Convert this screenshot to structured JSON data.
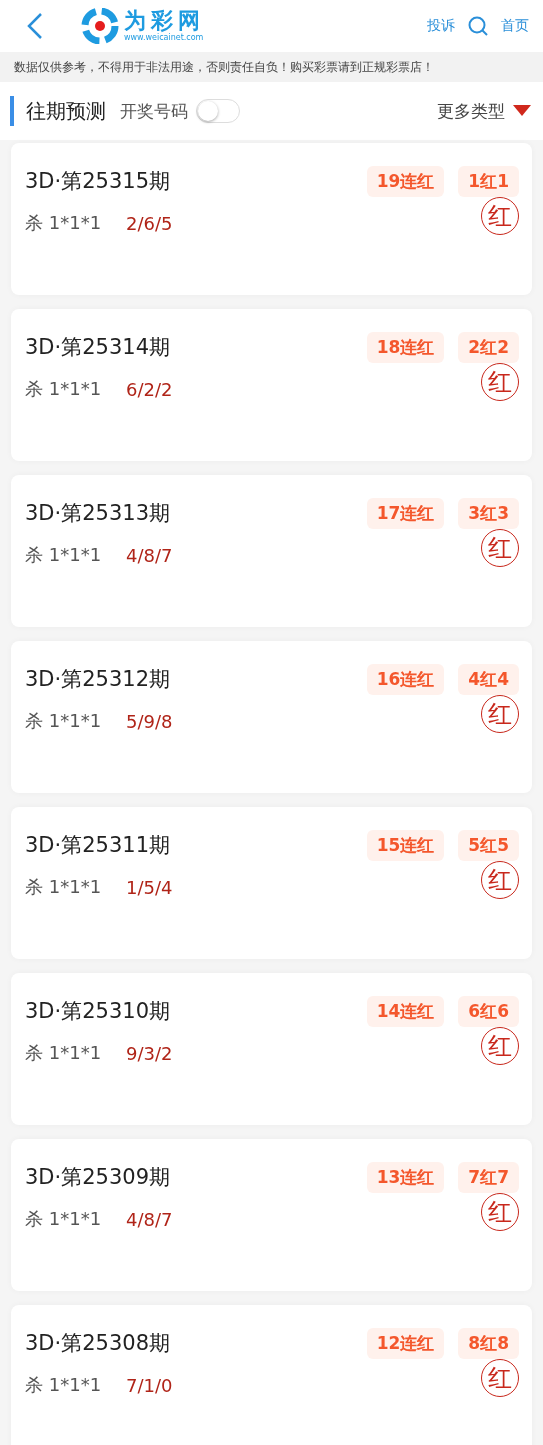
{
  "header": {
    "logo_name": "为彩网",
    "logo_url": "www.weicainet.com",
    "links": [
      "投诉",
      "首页"
    ]
  },
  "notice": "数据仅供参考，不得用于非法用途，否则责任自负！购买彩票请到正规彩票店！",
  "section": {
    "title": "往期预测",
    "toggle_label": "开奖号码",
    "toggle_on": false,
    "more": "更多类型"
  },
  "records": [
    {
      "period": "3D·第25315期",
      "streak": "19连红",
      "ratio": "1红1",
      "pick_label": "杀 1*1*1",
      "numbers": "2/6/5",
      "result": "红"
    },
    {
      "period": "3D·第25314期",
      "streak": "18连红",
      "ratio": "2红2",
      "pick_label": "杀 1*1*1",
      "numbers": "6/2/2",
      "result": "红"
    },
    {
      "period": "3D·第25313期",
      "streak": "17连红",
      "ratio": "3红3",
      "pick_label": "杀 1*1*1",
      "numbers": "4/8/7",
      "result": "红"
    },
    {
      "period": "3D·第25312期",
      "streak": "16连红",
      "ratio": "4红4",
      "pick_label": "杀 1*1*1",
      "numbers": "5/9/8",
      "result": "红"
    },
    {
      "period": "3D·第25311期",
      "streak": "15连红",
      "ratio": "5红5",
      "pick_label": "杀 1*1*1",
      "numbers": "1/5/4",
      "result": "红"
    },
    {
      "period": "3D·第25310期",
      "streak": "14连红",
      "ratio": "6红6",
      "pick_label": "杀 1*1*1",
      "numbers": "9/3/2",
      "result": "红"
    },
    {
      "period": "3D·第25309期",
      "streak": "13连红",
      "ratio": "7红7",
      "pick_label": "杀 1*1*1",
      "numbers": "4/8/7",
      "result": "红"
    },
    {
      "period": "3D·第25308期",
      "streak": "12连红",
      "ratio": "8红8",
      "pick_label": "杀 1*1*1",
      "numbers": "7/1/0",
      "result": "红"
    }
  ]
}
